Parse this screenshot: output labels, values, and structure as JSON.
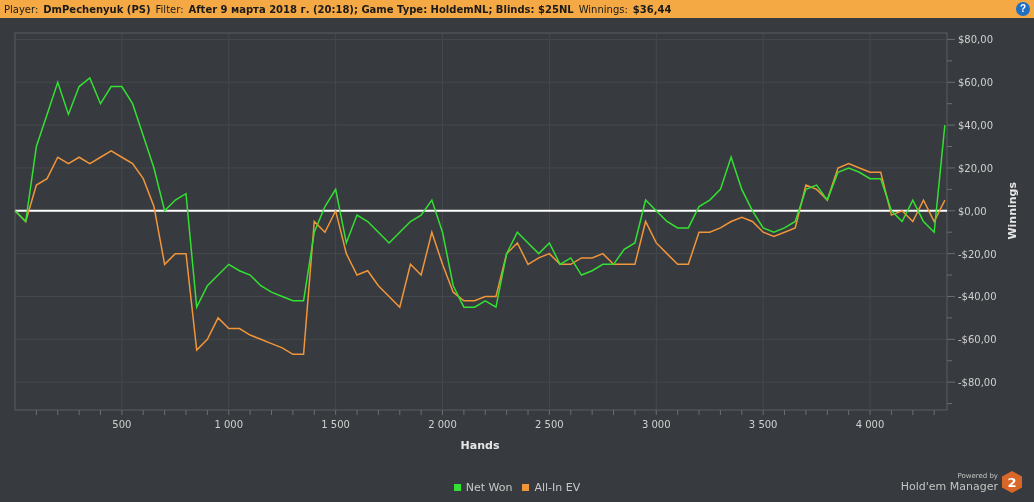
{
  "filter_bar": {
    "items": [
      {
        "label": "Player:",
        "value": "DmPechenyuk (PS)"
      },
      {
        "label": "Filter:",
        "value": "After 9 марта 2018 г. (20:18); Game Type: HoldemNL; Blinds: $25NL"
      },
      {
        "label": "Winnings:",
        "value": "$36,44"
      }
    ],
    "help": "?"
  },
  "chart_data": {
    "type": "line",
    "grid": true,
    "xlabel": "Hands",
    "ylabel": "Winnings",
    "xlim": [
      0,
      4360
    ],
    "ylim": [
      -93,
      83
    ],
    "xticks": [
      {
        "value": 500,
        "label": "500"
      },
      {
        "value": 1000,
        "label": "1 000"
      },
      {
        "value": 1500,
        "label": "1 500"
      },
      {
        "value": 2000,
        "label": "2 000"
      },
      {
        "value": 2500,
        "label": "2 500"
      },
      {
        "value": 3000,
        "label": "3 000"
      },
      {
        "value": 3500,
        "label": "3 500"
      },
      {
        "value": 4000,
        "label": "4 000"
      }
    ],
    "yticks": [
      {
        "value": 80,
        "label": "$80,00"
      },
      {
        "value": 60,
        "label": "$60,00"
      },
      {
        "value": 40,
        "label": "$40,00"
      },
      {
        "value": 20,
        "label": "$20,00"
      },
      {
        "value": 0,
        "label": "$0,00"
      },
      {
        "value": -20,
        "label": "-$20,00"
      },
      {
        "value": -40,
        "label": "-$40,00"
      },
      {
        "value": -60,
        "label": "-$60,00"
      },
      {
        "value": -80,
        "label": "-$80,00"
      }
    ],
    "x": [
      0,
      50,
      100,
      150,
      200,
      250,
      300,
      350,
      400,
      450,
      500,
      550,
      600,
      650,
      700,
      750,
      800,
      850,
      900,
      950,
      1000,
      1050,
      1100,
      1150,
      1200,
      1250,
      1300,
      1350,
      1400,
      1450,
      1500,
      1550,
      1600,
      1650,
      1700,
      1750,
      1800,
      1850,
      1900,
      1950,
      2000,
      2050,
      2100,
      2150,
      2200,
      2250,
      2300,
      2350,
      2400,
      2450,
      2500,
      2550,
      2600,
      2650,
      2700,
      2750,
      2800,
      2850,
      2900,
      2950,
      3000,
      3050,
      3100,
      3150,
      3200,
      3250,
      3300,
      3350,
      3400,
      3450,
      3500,
      3550,
      3600,
      3650,
      3700,
      3750,
      3800,
      3850,
      3900,
      3950,
      4000,
      4050,
      4100,
      4150,
      4200,
      4250,
      4300,
      4350
    ],
    "series": [
      {
        "name": "Net Won",
        "color": "#33e033",
        "values": [
          0,
          -5,
          30,
          45,
          60,
          45,
          58,
          62,
          50,
          58,
          58,
          50,
          35,
          20,
          0,
          5,
          8,
          -45,
          -35,
          -30,
          -25,
          -28,
          -30,
          -35,
          -38,
          -40,
          -42,
          -42,
          -10,
          2,
          10,
          -15,
          -2,
          -5,
          -10,
          -15,
          -10,
          -5,
          -2,
          5,
          -10,
          -35,
          -45,
          -45,
          -42,
          -45,
          -20,
          -10,
          -15,
          -20,
          -15,
          -25,
          -22,
          -30,
          -28,
          -25,
          -25,
          -18,
          -15,
          5,
          0,
          -5,
          -8,
          -8,
          2,
          5,
          10,
          25,
          10,
          0,
          -8,
          -10,
          -8,
          -5,
          10,
          12,
          5,
          18,
          20,
          18,
          15,
          15,
          0,
          -5,
          5,
          -5,
          -10,
          40
        ]
      },
      {
        "name": "All-In EV",
        "color": "#f0953a",
        "values": [
          0,
          -5,
          12,
          15,
          25,
          22,
          25,
          22,
          25,
          28,
          25,
          22,
          15,
          2,
          -25,
          -20,
          -20,
          -65,
          -60,
          -50,
          -55,
          -55,
          -58,
          -60,
          -62,
          -64,
          -67,
          -67,
          -5,
          -10,
          0,
          -20,
          -30,
          -28,
          -35,
          -40,
          -45,
          -25,
          -30,
          -10,
          -25,
          -38,
          -42,
          -42,
          -40,
          -40,
          -20,
          -15,
          -25,
          -22,
          -20,
          -25,
          -25,
          -22,
          -22,
          -20,
          -25,
          -25,
          -25,
          -5,
          -15,
          -20,
          -25,
          -25,
          -10,
          -10,
          -8,
          -5,
          -3,
          -5,
          -10,
          -12,
          -10,
          -8,
          12,
          10,
          5,
          20,
          22,
          20,
          18,
          18,
          -2,
          0,
          -5,
          5,
          -5,
          5
        ]
      }
    ]
  },
  "branding": {
    "caption": "Powered by",
    "product": "Hold'em Manager",
    "version": "2"
  }
}
